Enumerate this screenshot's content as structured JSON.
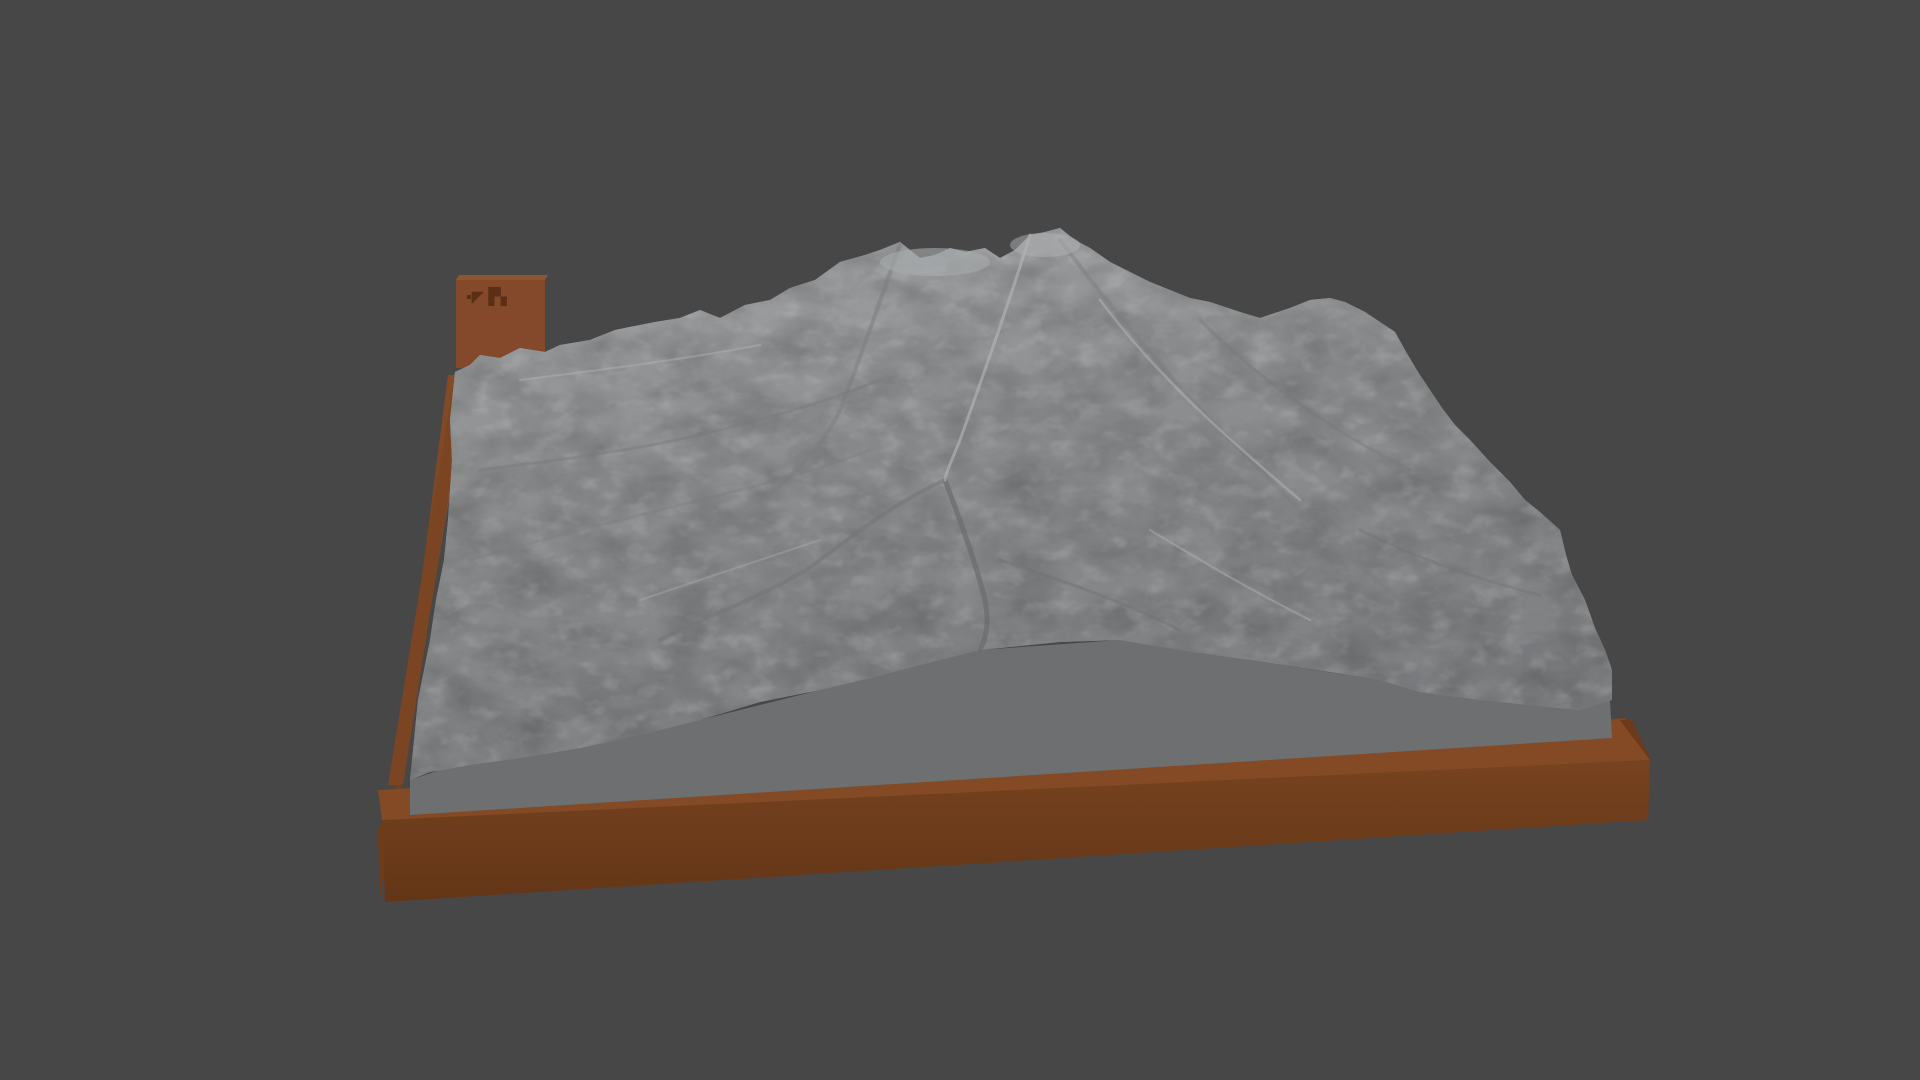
{
  "scene": {
    "background_color": "#474747",
    "model": {
      "subject": "terrain-relief-model",
      "terrain_color": "#8f9193",
      "terrain_front_color": "#6b6d6f",
      "base_color": "#7a4320",
      "base_front_color": "#6a3a1b",
      "label_block": {
        "glyphs": "N 🏔",
        "rendered_as_picture": true
      }
    }
  }
}
